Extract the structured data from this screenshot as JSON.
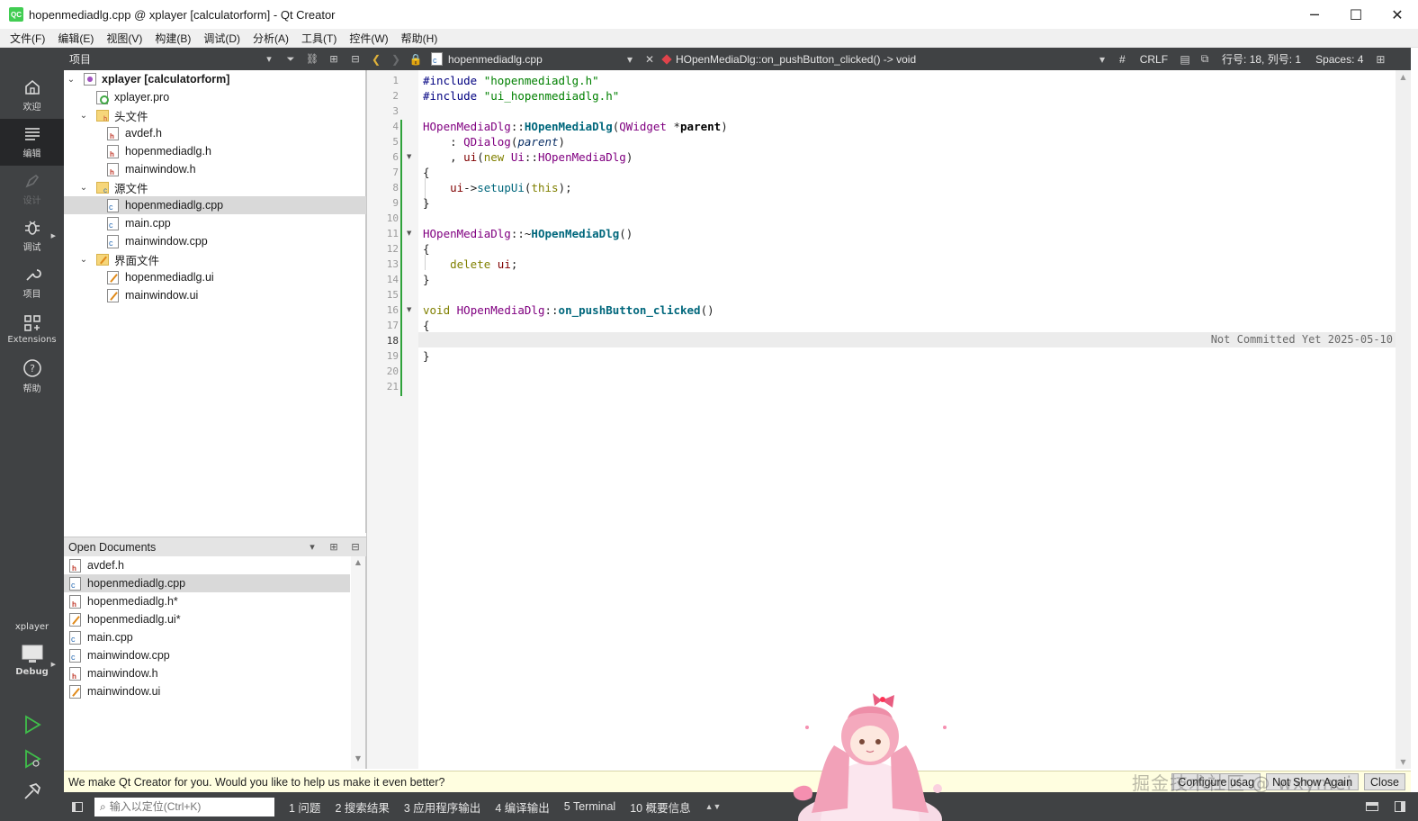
{
  "window": {
    "title": "hopenmediadlg.cpp @ xplayer [calculatorform] - Qt Creator",
    "logo": "QC",
    "controls": {
      "minimize": "─",
      "maximize": "☐",
      "close": "✕"
    }
  },
  "menu": [
    "文件(F)",
    "编辑(E)",
    "视图(V)",
    "构建(B)",
    "调试(D)",
    "分析(A)",
    "工具(T)",
    "控件(W)",
    "帮助(H)"
  ],
  "modes": [
    {
      "label": "欢迎",
      "icon": "home-icon"
    },
    {
      "label": "编辑",
      "icon": "edit-icon",
      "active": true
    },
    {
      "label": "设计",
      "icon": "design-icon",
      "disabled": true
    },
    {
      "label": "调试",
      "icon": "bug-icon"
    },
    {
      "label": "项目",
      "icon": "wrench-icon"
    },
    {
      "label": "Extensions",
      "icon": "extensions-icon"
    },
    {
      "label": "帮助",
      "icon": "help-icon"
    }
  ],
  "target": {
    "project": "xplayer",
    "config": "Debug"
  },
  "project_panel": {
    "title": "项目",
    "tree": [
      {
        "label": "xplayer [calculatorform]",
        "kind": "project"
      },
      {
        "label": "xplayer.pro",
        "kind": "pro"
      },
      {
        "label": "头文件",
        "kind": "folder-headers"
      },
      {
        "label": "avdef.h",
        "kind": "h"
      },
      {
        "label": "hopenmediadlg.h",
        "kind": "h"
      },
      {
        "label": "mainwindow.h",
        "kind": "h"
      },
      {
        "label": "源文件",
        "kind": "folder-sources"
      },
      {
        "label": "hopenmediadlg.cpp",
        "kind": "cpp",
        "selected": true
      },
      {
        "label": "main.cpp",
        "kind": "cpp"
      },
      {
        "label": "mainwindow.cpp",
        "kind": "cpp"
      },
      {
        "label": "界面文件",
        "kind": "folder-forms"
      },
      {
        "label": "hopenmediadlg.ui",
        "kind": "ui"
      },
      {
        "label": "mainwindow.ui",
        "kind": "ui"
      }
    ]
  },
  "open_documents": {
    "title": "Open Documents",
    "items": [
      {
        "label": "avdef.h",
        "kind": "h"
      },
      {
        "label": "hopenmediadlg.cpp",
        "kind": "cpp",
        "selected": true
      },
      {
        "label": "hopenmediadlg.h*",
        "kind": "h"
      },
      {
        "label": "hopenmediadlg.ui*",
        "kind": "ui"
      },
      {
        "label": "main.cpp",
        "kind": "cpp"
      },
      {
        "label": "mainwindow.cpp",
        "kind": "cpp"
      },
      {
        "label": "mainwindow.h",
        "kind": "h"
      },
      {
        "label": "mainwindow.ui",
        "kind": "ui"
      }
    ]
  },
  "editor_toolbar": {
    "file": "hopenmediadlg.cpp",
    "symbol": "HOpenMediaDlg::on_pushButton_clicked() -> void",
    "hash": "#",
    "line_ending": "CRLF",
    "position": "行号: 18, 列号: 1",
    "indent": "Spaces: 4"
  },
  "editor": {
    "line_numbers": [
      "1",
      "2",
      "3",
      "4",
      "5",
      "6",
      "7",
      "8",
      "9",
      "10",
      "11",
      "12",
      "13",
      "14",
      "15",
      "16",
      "17",
      "18",
      "19",
      "20",
      "21"
    ],
    "current_line": 18,
    "blame": "Not Committed Yet 2025-05-10"
  },
  "infobar": {
    "message": "We make Qt Creator for you. Would you like to help us make it even better?",
    "configure_button": "Configure usag",
    "dont_show_button": "Not Show Again",
    "close_button": "Close"
  },
  "watermark": "掘金技术社区 @ wxymei",
  "statusbar": {
    "locator_placeholder": "输入以定位(Ctrl+K)",
    "panes": [
      "1 问题",
      "2 搜索结果",
      "3 应用程序输出",
      "4 编译输出",
      "5 Terminal",
      "10 概要信息"
    ]
  },
  "colors": {
    "sidebar": "#404244",
    "sidebar_active": "#262729",
    "change_bar": "#2fa23b",
    "infobar": "#fffee0"
  }
}
